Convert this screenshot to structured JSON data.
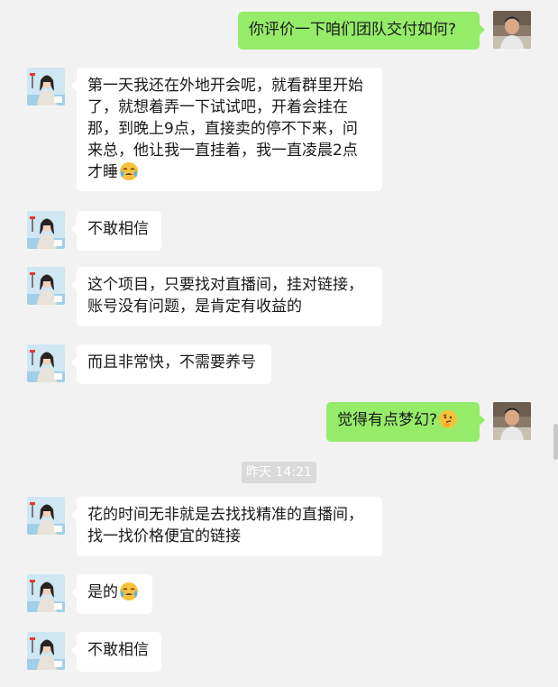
{
  "colors": {
    "background": "#f2f2f2",
    "bubble_self": "#95ec69",
    "bubble_other": "#ffffff",
    "timestamp_bg": "#dadada"
  },
  "messages": [
    {
      "sender": "self",
      "text": "你评价一下咱们团队交付如何?",
      "emoji": null
    },
    {
      "sender": "other",
      "text": "第一天我还在外地开会呢，就看群里开始了，就想着弄一下试试吧，开着会挂在那，到晚上9点，直接卖的停不下来，问来总，他让我一直挂着，我一直凌晨2点才睡",
      "emoji": "crying-face"
    },
    {
      "sender": "other",
      "text": "不敢相信",
      "emoji": null
    },
    {
      "sender": "other",
      "text": "这个项目，只要找对直播间，挂对链接，账号没有问题，是肯定有收益的",
      "emoji": null
    },
    {
      "sender": "other",
      "text": "而且非常快，不需要养号",
      "emoji": null
    },
    {
      "sender": "self",
      "text": "觉得有点梦幻?",
      "emoji": "thinking-face"
    },
    {
      "sender": "other",
      "text": "花的时间无非就是去找找精准的直播间，找一找价格便宜的链接",
      "emoji": null
    },
    {
      "sender": "other",
      "text": "是的",
      "emoji": "crying-face"
    },
    {
      "sender": "other",
      "text": "不敢相信",
      "emoji": null
    }
  ],
  "timestamp": "昨天 14:21"
}
